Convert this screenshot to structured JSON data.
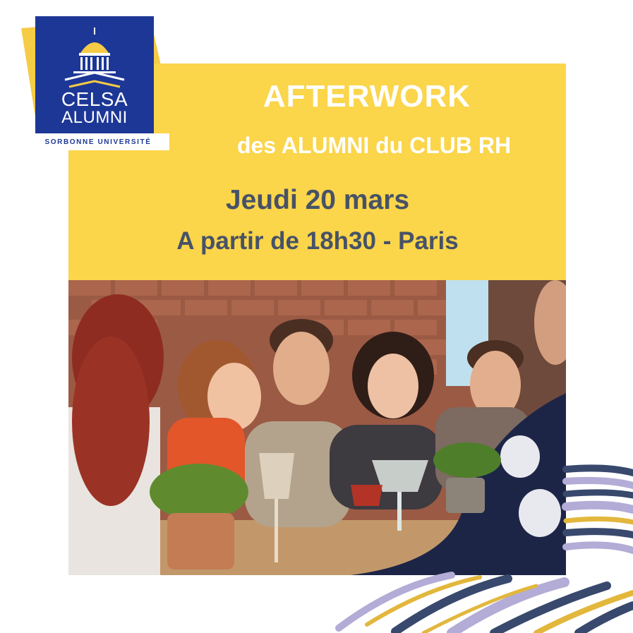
{
  "logo": {
    "line1": "CELSA",
    "line2": "ALUMNI",
    "subtitle": "SORBONNE UNIVERSITÉ",
    "icon": "dome-building-icon"
  },
  "event": {
    "title": "AFTERWORK",
    "subtitle": "des ALUMNI du CLUB RH",
    "date": "Jeudi 20 mars",
    "time_place": "A partir de 18h30 - Paris"
  },
  "photo": {
    "icon": "friends-at-bar-photo"
  },
  "colors": {
    "brand_blue": "#1d3796",
    "yellow": "#fbd54a",
    "text_gray": "#475267",
    "stroke_navy": "#38496d",
    "stroke_lavender": "#b2acd6",
    "stroke_gold": "#e2b73c"
  }
}
